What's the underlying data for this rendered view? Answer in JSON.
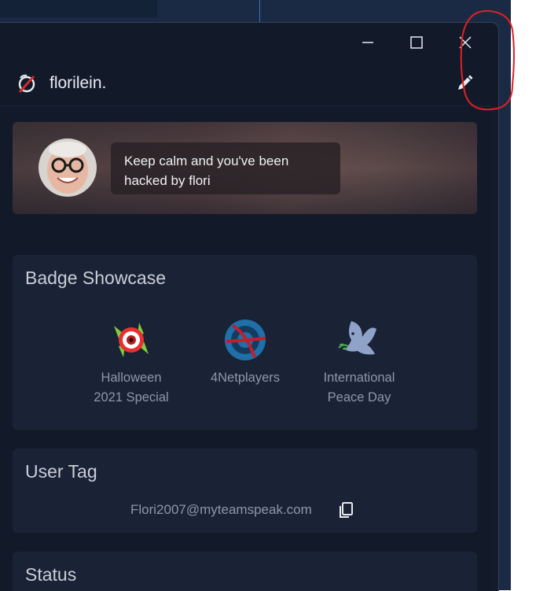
{
  "profile": {
    "username": "florilein.",
    "status_message": "Keep calm and you've been hacked by flori"
  },
  "icons": {
    "minimize": "minimize-icon",
    "maximize": "maximize-icon",
    "close": "close-icon",
    "edit": "pencil-icon",
    "copy": "copy-icon",
    "logo": "teamspeak-logo-icon"
  },
  "badge_showcase": {
    "title": "Badge Showcase",
    "badges": [
      {
        "label_line1": "Halloween",
        "label_line2": "2021 Special",
        "icon": "halloween-candy-badge-icon"
      },
      {
        "label_line1": "4Netplayers",
        "label_line2": "",
        "icon": "4netplayers-badge-icon"
      },
      {
        "label_line1": "International",
        "label_line2": "Peace Day",
        "icon": "peace-dove-badge-icon"
      }
    ]
  },
  "user_tag": {
    "title": "User Tag",
    "value": "Flori2007@myteamspeak.com"
  },
  "status": {
    "title": "Status"
  },
  "colors": {
    "window_bg": "#121a2a",
    "card_bg": "#1a2236",
    "text_primary": "#e8ecf2",
    "text_secondary": "#8e97a8",
    "annotation_red": "#e02020"
  }
}
